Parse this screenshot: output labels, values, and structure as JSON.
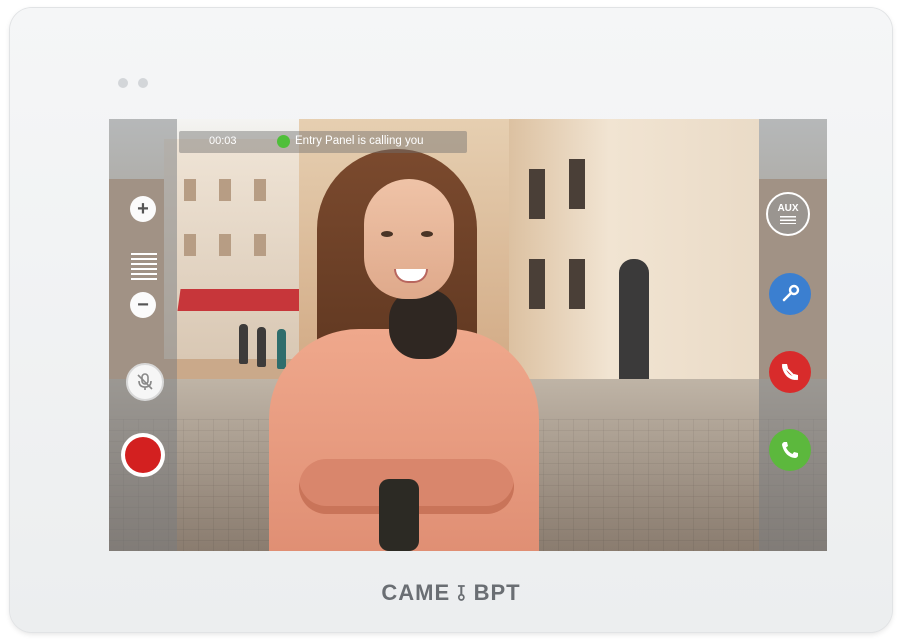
{
  "call": {
    "timer": "00:03",
    "status_text": "Entry Panel is calling you",
    "status_color": "#4fbf3a"
  },
  "controls": {
    "zoom_in_symbol": "+",
    "zoom_out_symbol": "−",
    "mute_icon": "microphone-muted-icon",
    "record_icon": "record-icon",
    "record_color": "#d32020"
  },
  "actions": {
    "aux_label": "AUX",
    "key_icon": "key-icon",
    "key_color": "#3b7fd0",
    "hangup_icon": "hang-up-icon",
    "hangup_color": "#d82b2b",
    "answer_icon": "phone-answer-icon",
    "answer_color": "#5cb83d"
  },
  "brand": {
    "text": "CAME ⫱ BPT"
  }
}
